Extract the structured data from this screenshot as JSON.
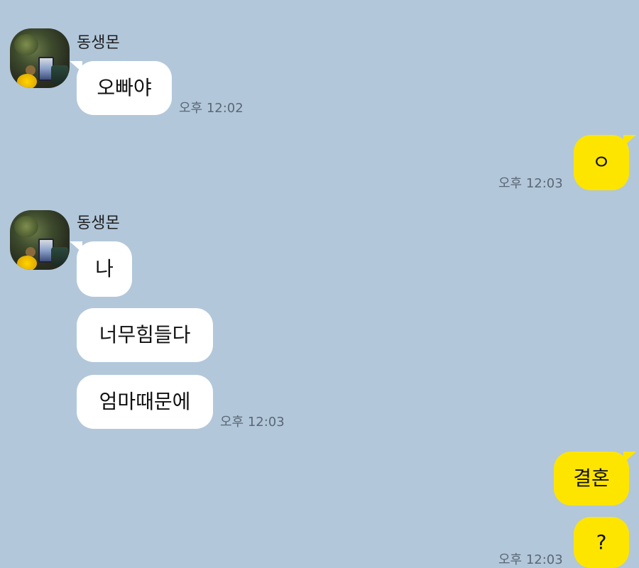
{
  "chat": {
    "groups": [
      {
        "sender": "동생몬",
        "messages": [
          "오빠야"
        ],
        "time": "오후 12:02"
      },
      {
        "sender": "me",
        "messages": [
          "ㅇ"
        ],
        "time": "오후 12:03"
      },
      {
        "sender": "동생몬",
        "messages": [
          "나",
          "너무힘들다",
          "엄마때문에"
        ],
        "time": "오후 12:03"
      },
      {
        "sender": "me",
        "messages": [
          "결혼",
          "?"
        ],
        "time": "오후 12:03"
      }
    ]
  },
  "colors": {
    "background": "#b2c7da",
    "incoming_bubble": "#ffffff",
    "outgoing_bubble": "#fee500",
    "timestamp": "#5b6775"
  },
  "icons": {
    "avatar": "profile-photo-avatar"
  }
}
